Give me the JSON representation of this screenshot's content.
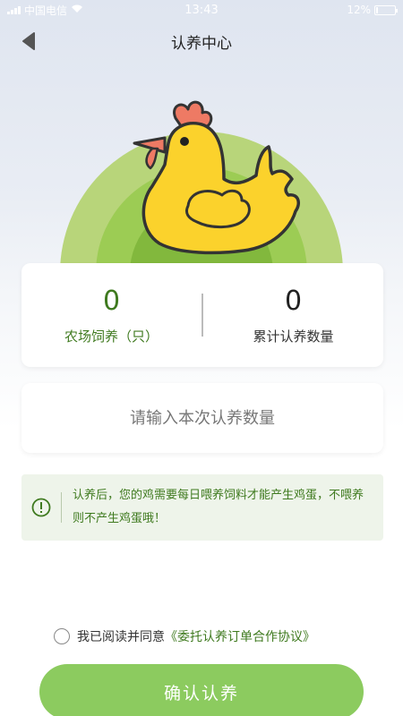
{
  "status_bar": {
    "carrier": "中国电信",
    "time": "13:43",
    "battery_percent": "12%",
    "battery_level": 0.12,
    "icons": [
      "signal-icon",
      "wifi-icon",
      "battery-icon"
    ]
  },
  "nav": {
    "title": "认养中心",
    "back_icon": "back-arrow-icon"
  },
  "hero": {
    "illustration": "chicken-illustration",
    "colors": {
      "ring_outer": "#b8d57a",
      "ring_mid": "#9ccc54",
      "ring_inner": "#82b83d",
      "chicken": "#fbd22c",
      "comb": "#ee7a64"
    }
  },
  "stats": {
    "farm_count": "0",
    "farm_label": "农场饲养（只）",
    "total_count": "0",
    "total_label": "累计认养数量"
  },
  "input": {
    "placeholder": "请输入本次认养数量",
    "value": ""
  },
  "notice": {
    "icon": "info-icon",
    "text": "认养后，您的鸡需要每日喂养饲料才能产生鸡蛋，不喂养则不产生鸡蛋哦！"
  },
  "agreement": {
    "checked": false,
    "text": "我已阅读并同意",
    "link": "《委托认养订单合作协议》"
  },
  "confirm_button": {
    "label": "确认认养"
  },
  "colors": {
    "accent_green": "#3f7a1f",
    "button_green": "#8ccb5f",
    "notice_bg": "#eef4ea"
  }
}
